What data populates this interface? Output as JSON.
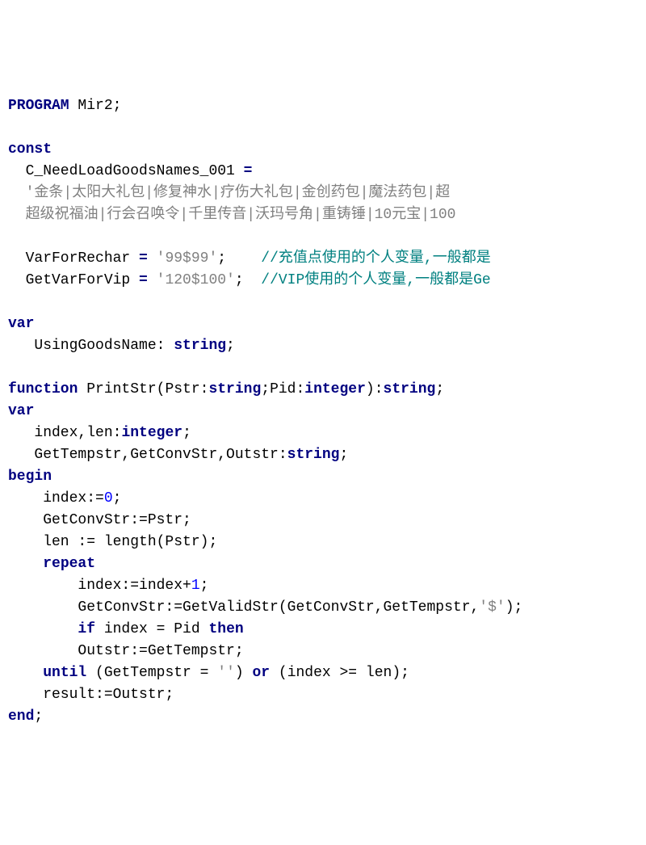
{
  "lines": [
    [
      {
        "t": "PROGRAM",
        "c": "kw"
      },
      {
        "t": " Mir2;",
        "c": "ident"
      }
    ],
    [],
    [
      {
        "t": "const",
        "c": "kw"
      }
    ],
    [
      {
        "t": "  C_NeedLoadGoodsNames_001 ",
        "c": "ident"
      },
      {
        "t": "=",
        "c": "op"
      }
    ],
    [
      {
        "t": "  ",
        "c": "ident"
      },
      {
        "t": "'金条|太阳大礼包|修复神水|疗伤大礼包|金创药包|魔法药包|超",
        "c": "str"
      }
    ],
    [
      {
        "t": "  ",
        "c": "ident"
      },
      {
        "t": "超级祝福油|行会召唤令|千里传音|沃玛号角|重铸锤|10元宝|100",
        "c": "str"
      }
    ],
    [],
    [
      {
        "t": "  VarForRechar ",
        "c": "ident"
      },
      {
        "t": "=",
        "c": "op"
      },
      {
        "t": " ",
        "c": "ident"
      },
      {
        "t": "'99$99'",
        "c": "str"
      },
      {
        "t": ";    ",
        "c": "ident"
      },
      {
        "t": "//充值点使用的个人变量,一般都是",
        "c": "cmt"
      }
    ],
    [
      {
        "t": "  GetVarForVip ",
        "c": "ident"
      },
      {
        "t": "=",
        "c": "op"
      },
      {
        "t": " ",
        "c": "ident"
      },
      {
        "t": "'120$100'",
        "c": "str"
      },
      {
        "t": ";  ",
        "c": "ident"
      },
      {
        "t": "//VIP使用的个人变量,一般都是Ge",
        "c": "cmt"
      }
    ],
    [],
    [
      {
        "t": "var",
        "c": "kw"
      }
    ],
    [
      {
        "t": "   UsingGoodsName: ",
        "c": "ident"
      },
      {
        "t": "string",
        "c": "type"
      },
      {
        "t": ";",
        "c": "ident"
      }
    ],
    [],
    [
      {
        "t": "function",
        "c": "kw"
      },
      {
        "t": " PrintStr(Pstr:",
        "c": "ident"
      },
      {
        "t": "string",
        "c": "type"
      },
      {
        "t": ";Pid:",
        "c": "ident"
      },
      {
        "t": "integer",
        "c": "type"
      },
      {
        "t": "):",
        "c": "ident"
      },
      {
        "t": "string",
        "c": "type"
      },
      {
        "t": ";",
        "c": "ident"
      }
    ],
    [
      {
        "t": "var",
        "c": "kw"
      }
    ],
    [
      {
        "t": "   index,len:",
        "c": "ident"
      },
      {
        "t": "integer",
        "c": "type"
      },
      {
        "t": ";",
        "c": "ident"
      }
    ],
    [
      {
        "t": "   GetTempstr,GetConvStr,Outstr:",
        "c": "ident"
      },
      {
        "t": "string",
        "c": "type"
      },
      {
        "t": ";",
        "c": "ident"
      }
    ],
    [
      {
        "t": "begin",
        "c": "kw"
      }
    ],
    [
      {
        "t": "    index:=",
        "c": "ident"
      },
      {
        "t": "0",
        "c": "num"
      },
      {
        "t": ";",
        "c": "ident"
      }
    ],
    [
      {
        "t": "    GetConvStr:=Pstr;",
        "c": "ident"
      }
    ],
    [
      {
        "t": "    len := length(Pstr);",
        "c": "ident"
      }
    ],
    [
      {
        "t": "    ",
        "c": "ident"
      },
      {
        "t": "repeat",
        "c": "kw"
      }
    ],
    [
      {
        "t": "        index:=index+",
        "c": "ident"
      },
      {
        "t": "1",
        "c": "num"
      },
      {
        "t": ";",
        "c": "ident"
      }
    ],
    [
      {
        "t": "        GetConvStr:=GetValidStr(GetConvStr,GetTempstr,",
        "c": "ident"
      },
      {
        "t": "'$'",
        "c": "str"
      },
      {
        "t": ");",
        "c": "ident"
      }
    ],
    [
      {
        "t": "        ",
        "c": "ident"
      },
      {
        "t": "if",
        "c": "kw"
      },
      {
        "t": " index = Pid ",
        "c": "ident"
      },
      {
        "t": "then",
        "c": "kw"
      }
    ],
    [
      {
        "t": "        Outstr:=GetTempstr;",
        "c": "ident"
      }
    ],
    [
      {
        "t": "    ",
        "c": "ident"
      },
      {
        "t": "until",
        "c": "kw"
      },
      {
        "t": " (GetTempstr = ",
        "c": "ident"
      },
      {
        "t": "''",
        "c": "str"
      },
      {
        "t": ") ",
        "c": "ident"
      },
      {
        "t": "or",
        "c": "kw"
      },
      {
        "t": " (index >= len);",
        "c": "ident"
      }
    ],
    [
      {
        "t": "    result:=Outstr;",
        "c": "ident"
      }
    ],
    [
      {
        "t": "end",
        "c": "kw"
      },
      {
        "t": ";",
        "c": "ident"
      }
    ]
  ]
}
